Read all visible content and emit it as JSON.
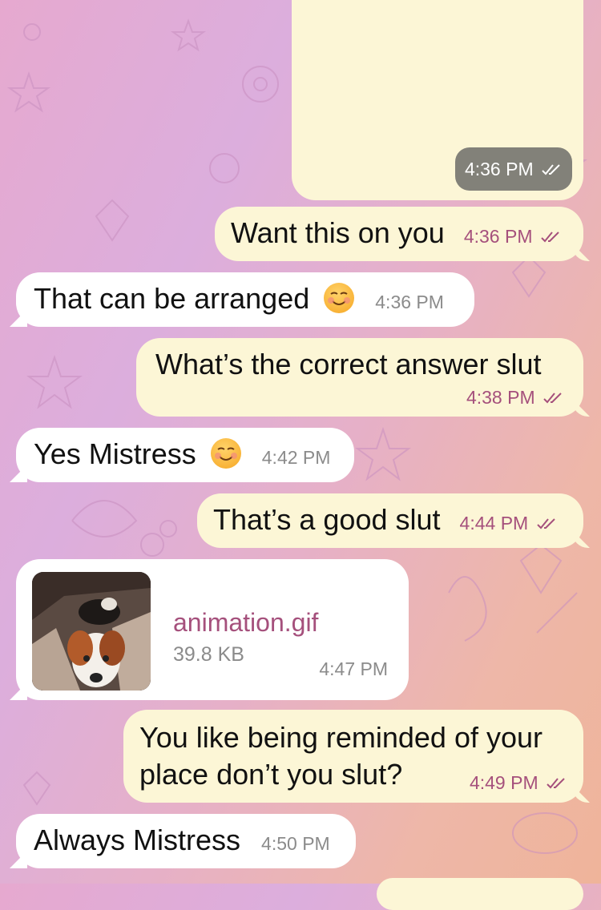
{
  "chat": {
    "messages": [
      {
        "id": "m0",
        "direction": "out",
        "kind": "media",
        "time": "4:36 PM",
        "read": true
      },
      {
        "id": "m1",
        "direction": "out",
        "text": "Want this on you",
        "time": "4:36 PM",
        "read": true
      },
      {
        "id": "m2",
        "direction": "in",
        "text": "That can be arranged",
        "emoji": "smiling-face-icon",
        "time": "4:36 PM"
      },
      {
        "id": "m3",
        "direction": "out",
        "text": "What’s the correct answer slut",
        "time": "4:38 PM",
        "read": true
      },
      {
        "id": "m4",
        "direction": "in",
        "text": "Yes Mistress",
        "emoji": "smiling-face-icon",
        "time": "4:42 PM"
      },
      {
        "id": "m5",
        "direction": "out",
        "text": "That’s a good slut",
        "time": "4:44 PM",
        "read": true
      },
      {
        "id": "m6",
        "direction": "in",
        "kind": "file",
        "file_name": "animation.gif",
        "file_size": "39.8 KB",
        "time": "4:47 PM"
      },
      {
        "id": "m7",
        "direction": "out",
        "text_line1": "You like being reminded of your",
        "text_line2": "place don’t you slut?",
        "time": "4:49 PM",
        "read": true
      },
      {
        "id": "m8",
        "direction": "in",
        "text": "Always Mistress",
        "time": "4:50 PM"
      }
    ]
  },
  "colors": {
    "outgoing_bubble": "#fcf6d6",
    "incoming_bubble": "#ffffff",
    "time_outgoing": "#a5507c",
    "time_incoming": "#8b8b8b",
    "file_link": "#a5507c"
  },
  "icons": {
    "read_receipt": "double-check-icon",
    "emoji": "smiling-face-icon"
  }
}
